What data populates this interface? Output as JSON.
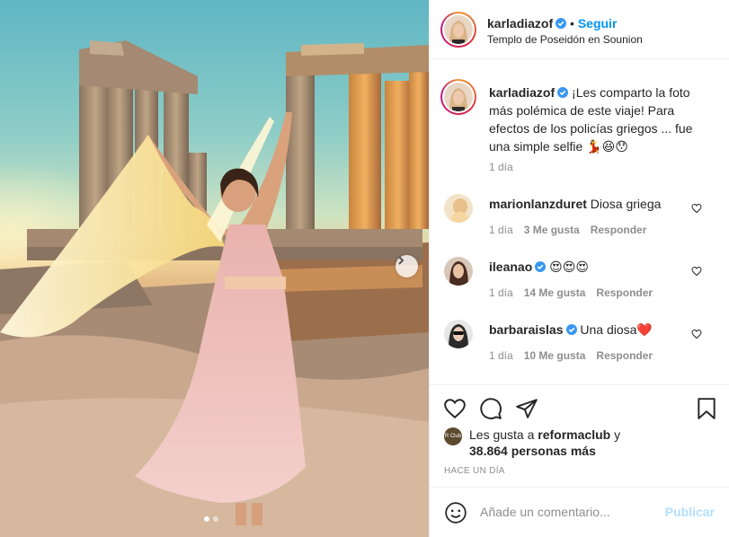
{
  "post": {
    "username": "karladiazof",
    "follow_label": "Seguir",
    "location": "Templo de Poseidón en Sounion"
  },
  "caption": {
    "username": "karladiazof",
    "text": "¡Les comparto la foto más polémica de este viaje! Para efectos de los policías griegos ... fue una simple selfie 💃😆😯",
    "time": "1 día"
  },
  "comments": [
    {
      "username": "marionlanzduret",
      "verified": false,
      "text": "Diosa griega",
      "time": "1 día",
      "likes": "3 Me gusta",
      "reply": "Responder"
    },
    {
      "username": "ileanao",
      "verified": true,
      "text": "😍😍😍",
      "time": "1 día",
      "likes": "14 Me gusta",
      "reply": "Responder"
    },
    {
      "username": "barbaraislas",
      "verified": true,
      "text": "Una diosa❤️",
      "time": "1 día",
      "likes": "10 Me gusta",
      "reply": "Responder"
    }
  ],
  "likes": {
    "prefix": "Les gusta a ",
    "user": "reformaclub",
    "middle": " y",
    "count": "38.864 personas más",
    "avatar_text": "R Club"
  },
  "time_ago": "HACE UN DÍA",
  "comment_box": {
    "placeholder": "Añade un comentario...",
    "publish_label": "Publicar"
  },
  "carousel": {
    "current": 1,
    "total": 2
  },
  "colors": {
    "accent": "#0095f6",
    "muted": "#8e8e8e",
    "text": "#262626",
    "heart": "#ed4956"
  },
  "icons": [
    "verified-icon",
    "heart-icon",
    "comment-icon",
    "share-icon",
    "bookmark-icon",
    "emoji-icon",
    "chevron-right-icon"
  ]
}
